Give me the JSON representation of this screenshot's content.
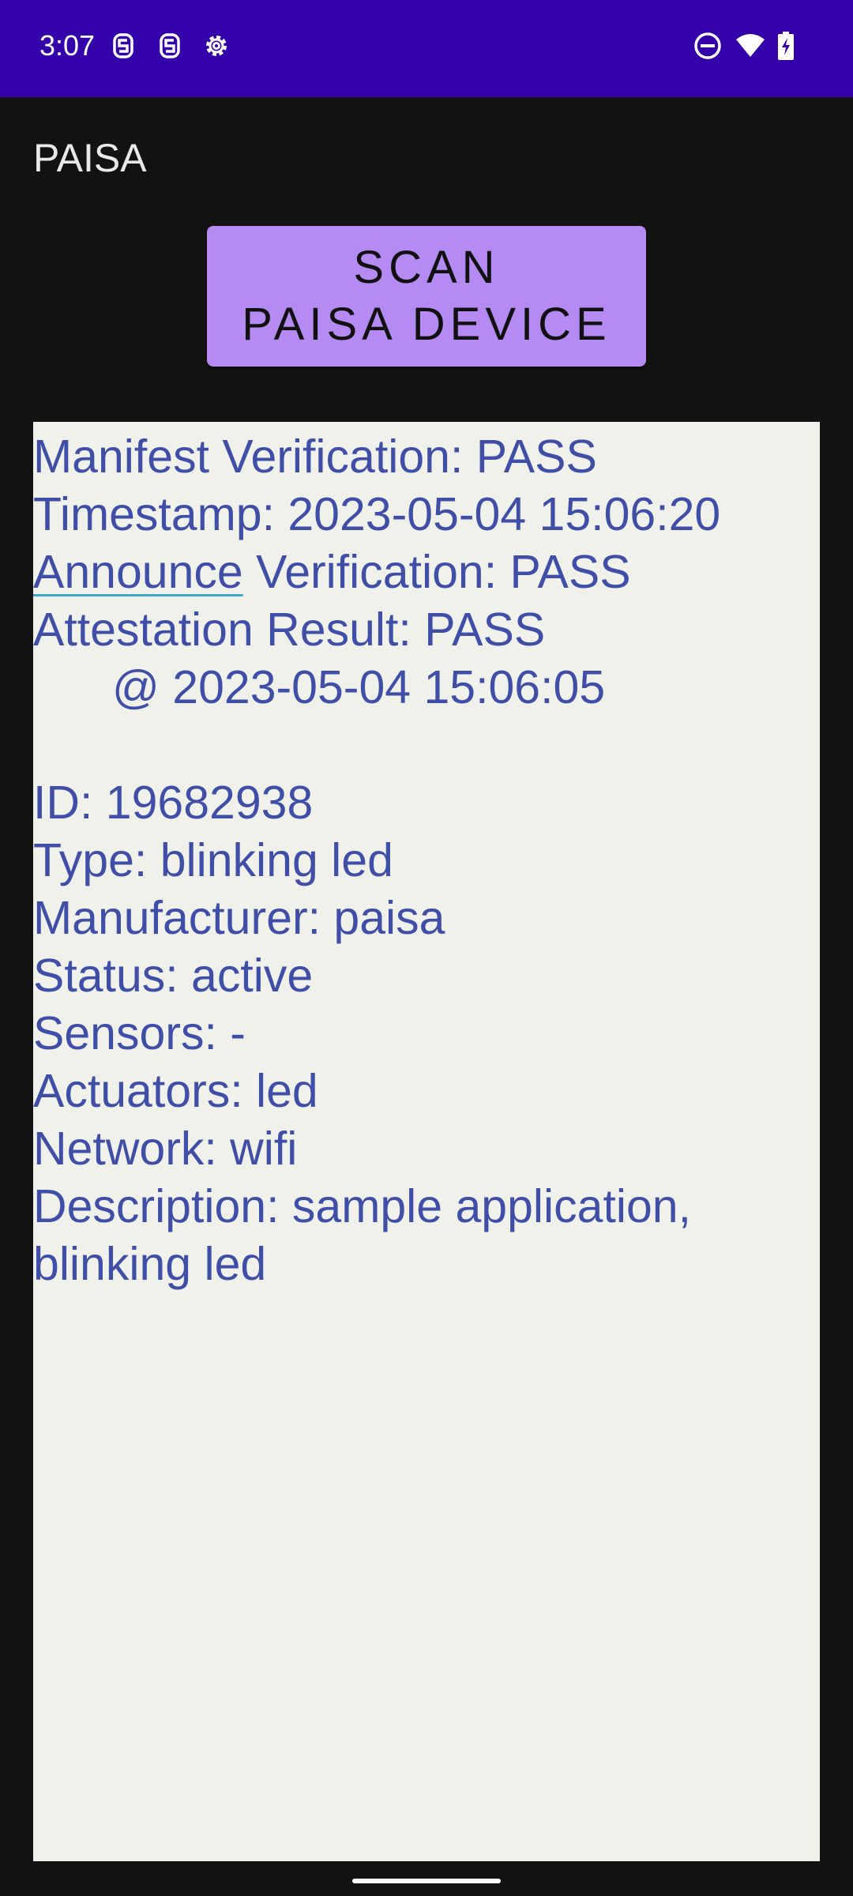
{
  "status_bar": {
    "time": "3:07",
    "background": "#3300AA",
    "icons_left": [
      "notification-s-icon",
      "notification-s-icon",
      "settings-gear-icon"
    ],
    "icons_right": [
      "do-not-disturb-icon",
      "wifi-icon",
      "battery-charging-icon"
    ]
  },
  "app": {
    "title": "PAISA"
  },
  "scan_button": {
    "line1": "SCAN",
    "line2": "PAISA DEVICE",
    "color": "#B58BF3"
  },
  "info": {
    "text_color": "#3F4FA8",
    "manifest": "Manifest Verification: PASS",
    "timestamp": "Timestamp: 2023-05-04 15:06:20",
    "announce_word": "Announce",
    "announce_rest": " Verification: PASS",
    "attestation": "Attestation Result: PASS",
    "attestation_time": "@ 2023-05-04 15:06:05",
    "id": "ID: 19682938",
    "type": "Type: blinking led",
    "manufacturer": "Manufacturer: paisa",
    "status": "Status: active",
    "sensors": "Sensors: -",
    "actuators": "Actuators: led",
    "network": "Network: wifi",
    "description_1": "Description: sample application,",
    "description_2": "blinking led"
  }
}
